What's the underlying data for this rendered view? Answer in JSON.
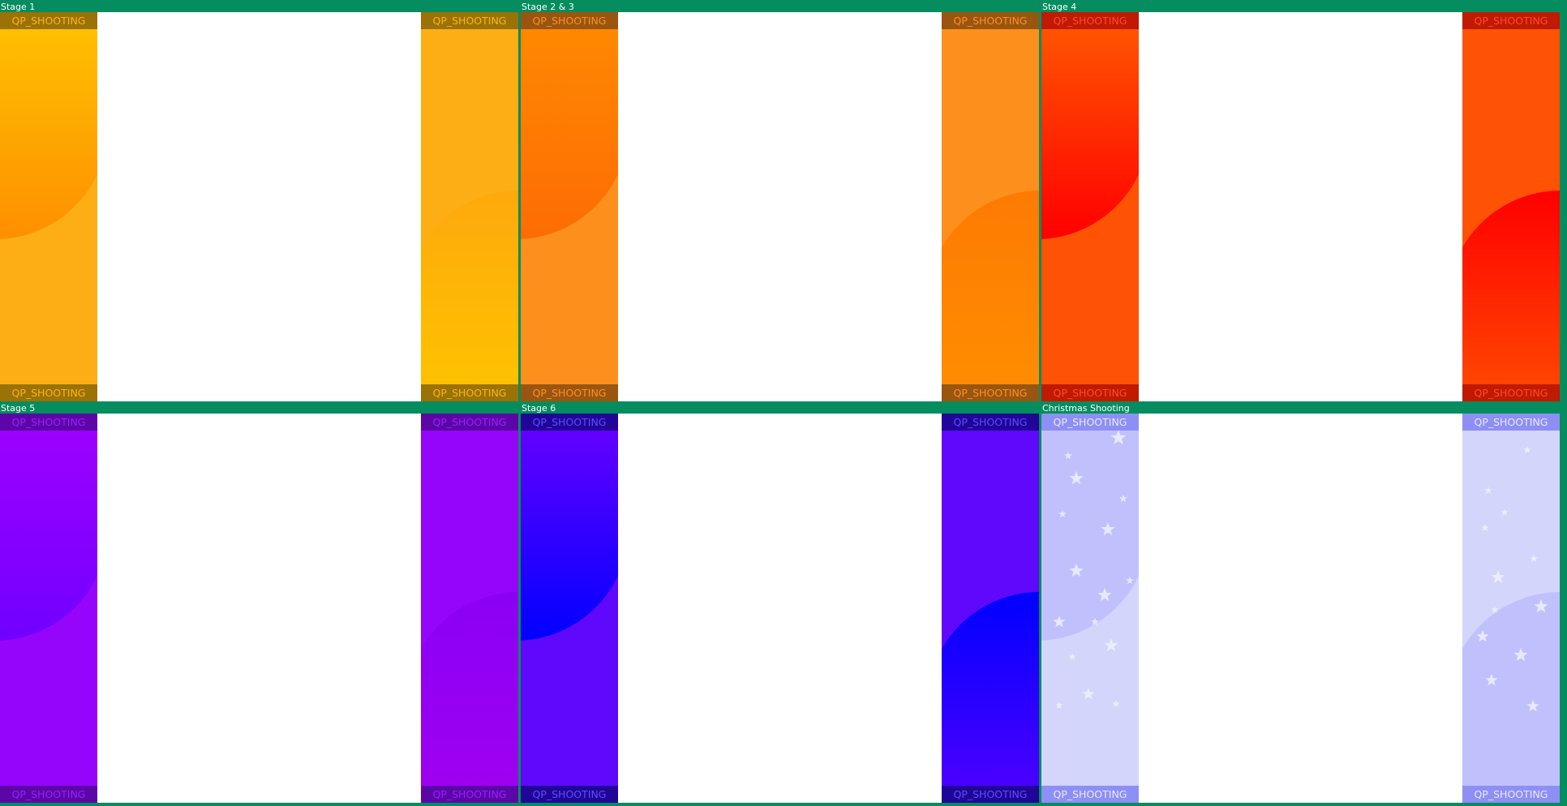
{
  "window": {
    "background": "#058c5f"
  },
  "panels": [
    {
      "title": "Stage 1",
      "label": "QP_SHOOTING",
      "bar_bg": "#9a7205",
      "bar_text": "#fcb416",
      "left": {
        "base": "#fdae14",
        "grad_top": "#ffc300",
        "grad_bottom": "#fe8f00"
      },
      "right": {
        "base": "#fdae14",
        "grad_top": "#fea90c",
        "grad_bottom": "#ffc300"
      },
      "stars": false
    },
    {
      "title": "Stage 2 & 3",
      "label": "QP_SHOOTING",
      "bar_bg": "#9a5510",
      "bar_text": "#fc9025",
      "left": {
        "base": "#fd8f1d",
        "grad_top": "#ff8a00",
        "grad_bottom": "#fd6c05"
      },
      "right": {
        "base": "#fd8f1d",
        "grad_top": "#fe7a03",
        "grad_bottom": "#ff8e00"
      },
      "stars": false
    },
    {
      "title": "Stage 4",
      "label": "QP_SHOOTING",
      "bar_bg": "#c01a02",
      "bar_text": "#fe4b2a",
      "left": {
        "base": "#fe5304",
        "grad_top": "#ff5a00",
        "grad_bottom": "#ff0000"
      },
      "right": {
        "base": "#fe5304",
        "grad_top": "#ff0000",
        "grad_bottom": "#ff4a00"
      },
      "stars": false
    },
    {
      "title": "Stage 5",
      "label": "QP_SHOOTING",
      "bar_bg": "#5c06a8",
      "bar_text": "#9a1fff",
      "left": {
        "base": "#9505fc",
        "grad_top": "#a000ff",
        "grad_bottom": "#7000ff"
      },
      "right": {
        "base": "#9505fc",
        "grad_top": "#8a00f5",
        "grad_bottom": "#a000f0"
      },
      "stars": false
    },
    {
      "title": "Stage 6",
      "label": "QP_SHOOTING",
      "bar_bg": "#200598",
      "bar_text": "#5b4dff",
      "left": {
        "base": "#5f08fc",
        "grad_top": "#6a00ff",
        "grad_bottom": "#0000ff"
      },
      "right": {
        "base": "#5f08fc",
        "grad_top": "#0000ff",
        "grad_bottom": "#5000ff"
      },
      "stars": false
    },
    {
      "title": "Christmas Shooting",
      "label": "QP_SHOOTING",
      "bar_bg": "#8e8ff5",
      "bar_text": "#e8e8ff",
      "left": {
        "base": "#d3d5fa",
        "grad_top": "#c0c1fc",
        "grad_bottom": "#c0c1fc"
      },
      "right": {
        "base": "#d3d5fa",
        "grad_top": "#c0c1fc",
        "grad_bottom": "#c0c1fc"
      },
      "stars": true
    }
  ]
}
